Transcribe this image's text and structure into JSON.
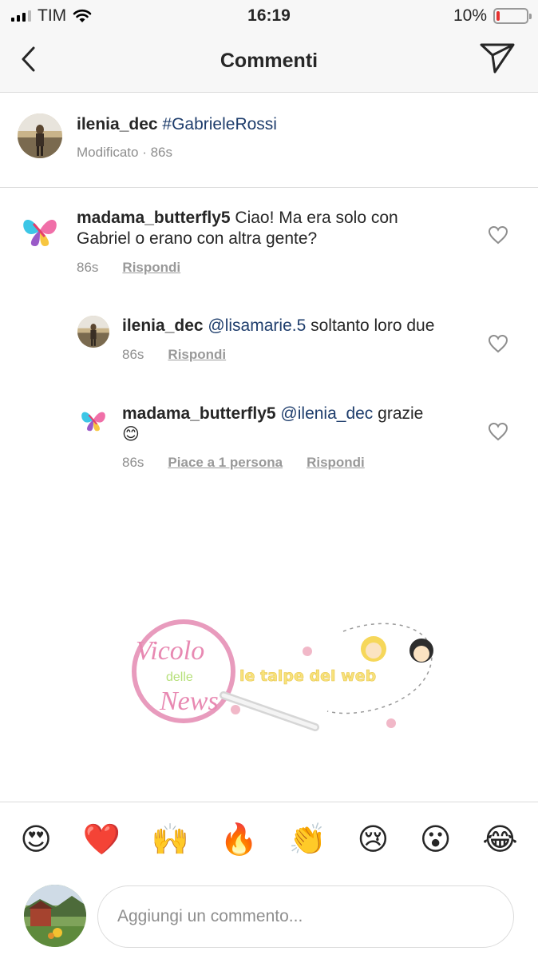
{
  "status_bar": {
    "carrier": "TIM",
    "time": "16:19",
    "battery_percent": "10%",
    "battery_level": 0.1,
    "icons": [
      "signal-icon",
      "wifi-icon",
      "battery-icon"
    ]
  },
  "nav": {
    "title": "Commenti",
    "back_icon": "chevron-left-icon",
    "send_icon": "paper-plane-icon"
  },
  "caption": {
    "username": "ilenia_dec",
    "text": "#GabrieleRossi",
    "meta": "Modificato · 86s"
  },
  "comments": [
    {
      "username": "madama_butterfly5",
      "text_line1": "Ciao! Ma era solo con",
      "text_line2": "Gabriel o erano con altra gente?",
      "time": "86s",
      "reply": "Rispondi"
    },
    {
      "username": "ilenia_dec",
      "mention": "@lisamarie.5",
      "text": "soltanto loro due",
      "time": "86s",
      "reply": "Rispondi"
    },
    {
      "username": "madama_butterfly5",
      "mention": "@ilenia_dec",
      "text": "grazie",
      "emoji": "😊",
      "time": "86s",
      "likes": "Piace a 1 persona",
      "reply": "Rispondi"
    }
  ],
  "watermark": {
    "logo_line1": "Vicolo",
    "logo_line2": "delle",
    "logo_line3": "News",
    "tagline": "le talpe del web"
  },
  "emoji_bar": [
    "😍",
    "❤️",
    "🙌",
    "🔥",
    "👏",
    "😢",
    "😮",
    "😂"
  ],
  "input": {
    "placeholder": "Aggiungi un commento..."
  },
  "colors": {
    "mention": "#1e3d6c",
    "meta_gray": "#8e8e8e",
    "divider": "#dbdbdb",
    "battery_low": "#e5312f"
  }
}
